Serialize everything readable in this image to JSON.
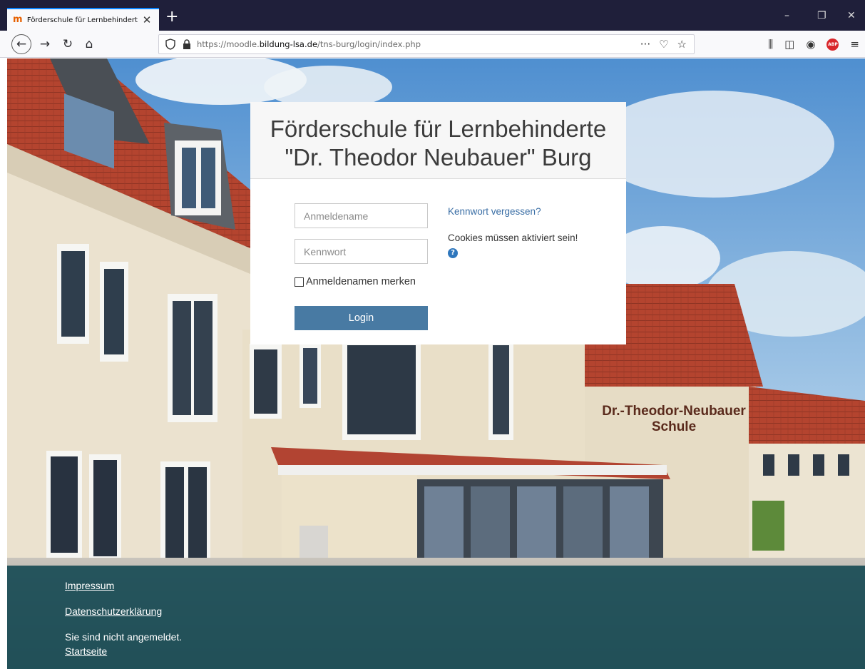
{
  "browser": {
    "tab_title": "Förderschule für Lernbehindert",
    "url_prefix": "https://moodle.",
    "url_domain": "bildung-lsa.de",
    "url_path": "/tns-burg/login/index.php",
    "page_actions_label": "···"
  },
  "login": {
    "title_line1": "Förderschule für Lernbehinderte",
    "title_line2": "\"Dr. Theodor Neubauer\" Burg",
    "username_placeholder": "Anmeldename",
    "password_placeholder": "Kennwort",
    "remember_label": "Anmeldenamen merken",
    "login_button": "Login",
    "forgot_link": "Kennwort vergessen?",
    "cookies_notice": "Cookies müssen aktiviert sein!"
  },
  "background": {
    "sign_line1": "Dr.-Theodor-Neubauer",
    "sign_line2": "Schule"
  },
  "footer": {
    "impressum": "Impressum",
    "datenschutz": "Datenschutzerklärung",
    "status": "Sie sind nicht angemeldet.",
    "startseite": "Startseite"
  },
  "colors": {
    "login_button": "#487aa3",
    "footer_bg": "#144852",
    "link": "#3a6ea5"
  }
}
